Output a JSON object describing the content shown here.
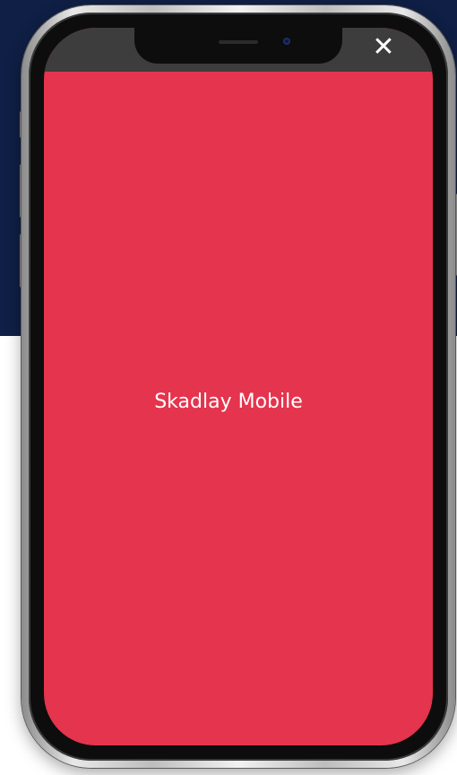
{
  "overlay": {
    "close_symbol": "✕",
    "close_icon": "close-icon",
    "background_color": "#0f1f45"
  },
  "device": {
    "model_frame": "phone",
    "screen_color": "#e5344d",
    "status_bar_color": "#3d3d3d"
  },
  "app": {
    "title": "Skadlay Mobile"
  }
}
